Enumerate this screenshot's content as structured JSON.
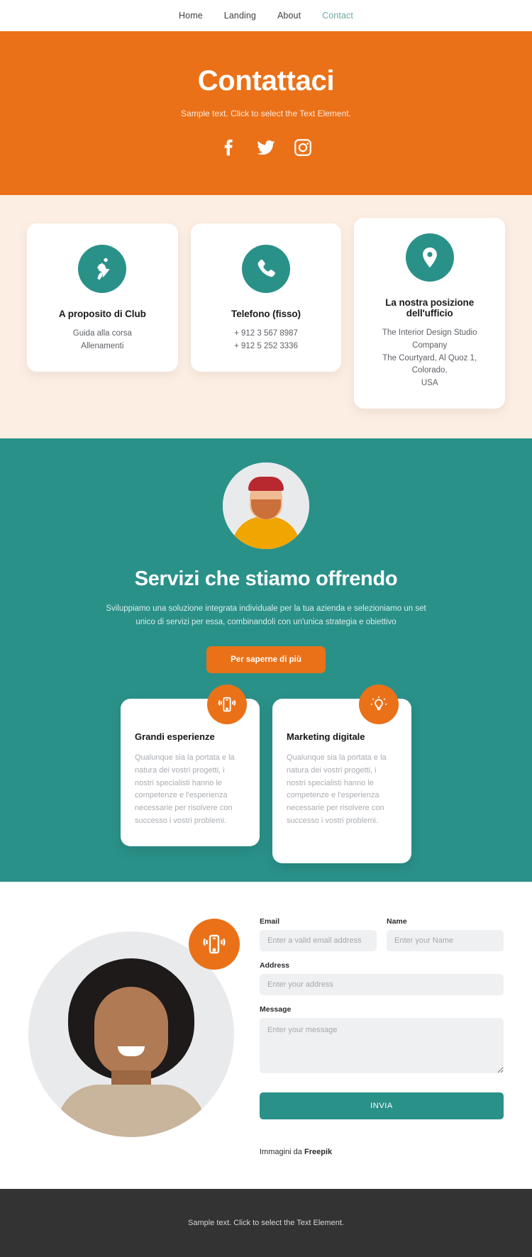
{
  "nav": {
    "items": [
      {
        "label": "Home",
        "active": false
      },
      {
        "label": "Landing",
        "active": false
      },
      {
        "label": "About",
        "active": false
      },
      {
        "label": "Contact",
        "active": true
      }
    ]
  },
  "hero": {
    "title": "Contattaci",
    "subtitle": "Sample text. Click to select the Text Element.",
    "background_color": "#ea7118",
    "socials": [
      {
        "name": "facebook-icon"
      },
      {
        "name": "twitter-icon"
      },
      {
        "name": "instagram-icon"
      }
    ]
  },
  "contact_cards": {
    "background_color": "#fdeee3",
    "icon_color": "#2a9189",
    "items": [
      {
        "icon": "running-icon",
        "title": "A proposito di Club",
        "lines": [
          "Guida alla corsa",
          "Allenamenti"
        ]
      },
      {
        "icon": "phone-icon",
        "title": "Telefono (fisso)",
        "lines": [
          "+ 912 3 567 8987",
          "+ 912 5 252 3336"
        ]
      },
      {
        "icon": "map-pin-icon",
        "title": "La nostra posizione dell'ufficio",
        "lines": [
          "The Interior Design Studio Company",
          "The Courtyard, Al Quoz 1, Colorado,",
          "USA"
        ]
      }
    ]
  },
  "services": {
    "background_color": "#2a9189",
    "title": "Servizi che stiamo offrendo",
    "description": "Sviluppiamo una soluzione integrata individuale per la tua azienda e selezioniamo un set unico di servizi per essa, combinandoli con un'unica strategia e obiettivo",
    "cta_label": "Per saperne di più",
    "cta_color": "#ea7118",
    "cards": [
      {
        "icon": "vibrating-phone-icon",
        "title": "Grandi esperienze",
        "text": "Qualunque sia la portata e la natura dei vostri progetti, i nostri specialisti hanno le competenze e l'esperienza necessarie per risolvere con successo i vostri problemi."
      },
      {
        "icon": "lightbulb-icon",
        "title": "Marketing digitale",
        "text": "Qualunque sia la portata e la natura dei vostri progetti, i nostri specialisti hanno le competenze e l'esperienza necessarie per risolvere con successo i vostri problemi."
      }
    ]
  },
  "contact_form": {
    "badge_icon": "mobile-ring-icon",
    "fields": {
      "email": {
        "label": "Email",
        "placeholder": "Enter a valid email address",
        "value": ""
      },
      "name": {
        "label": "Name",
        "placeholder": "Enter your Name",
        "value": ""
      },
      "address": {
        "label": "Address",
        "placeholder": "Enter your address",
        "value": ""
      },
      "message": {
        "label": "Message",
        "placeholder": "Enter your message",
        "value": ""
      }
    },
    "submit_label": "INVIA",
    "submit_color": "#2a9189",
    "credit_prefix": "Immagini da ",
    "credit_brand": "Freepik"
  },
  "footer": {
    "background_color": "#333333",
    "text": "Sample text. Click to select the Text Element."
  }
}
